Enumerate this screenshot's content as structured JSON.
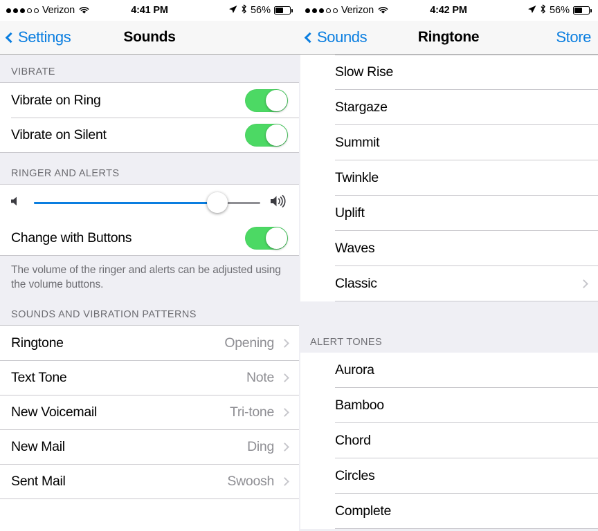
{
  "left": {
    "statusbar": {
      "carrier": "Verizon",
      "signal_filled": 3,
      "signal_hollow": 2,
      "wifi_icon": "wifi-icon",
      "time": "4:41 PM",
      "location_icon": "location-arrow-icon",
      "bluetooth_icon": "bluetooth-icon",
      "battery_percent": "56%",
      "battery_level": 56
    },
    "navbar": {
      "back_label": "Settings",
      "back_icon": "chevron-left-icon",
      "title": "Sounds"
    },
    "vibrate": {
      "header": "VIBRATE",
      "rows": [
        {
          "label": "Vibrate on Ring",
          "toggle": "on"
        },
        {
          "label": "Vibrate on Silent",
          "toggle": "on"
        }
      ]
    },
    "ringer": {
      "header": "RINGER AND ALERTS",
      "slider": {
        "min_icon": "speaker-low-icon",
        "max_icon": "speaker-high-icon",
        "value": 81
      },
      "change_with_buttons": {
        "label": "Change with Buttons",
        "toggle": "on"
      },
      "footer": "The volume of the ringer and alerts can be adjusted using the volume buttons."
    },
    "sounds": {
      "header": "SOUNDS AND VIBRATION PATTERNS",
      "rows": [
        {
          "label": "Ringtone",
          "value": "Opening"
        },
        {
          "label": "Text Tone",
          "value": "Note"
        },
        {
          "label": "New Voicemail",
          "value": "Tri-tone"
        },
        {
          "label": "New Mail",
          "value": "Ding"
        },
        {
          "label": "Sent Mail",
          "value": "Swoosh"
        }
      ]
    }
  },
  "right": {
    "statusbar": {
      "carrier": "Verizon",
      "signal_filled": 3,
      "signal_hollow": 2,
      "wifi_icon": "wifi-icon",
      "time": "4:42 PM",
      "location_icon": "location-arrow-icon",
      "bluetooth_icon": "bluetooth-icon",
      "battery_percent": "56%",
      "battery_level": 56
    },
    "navbar": {
      "back_label": "Sounds",
      "back_icon": "chevron-left-icon",
      "title": "Ringtone",
      "action_label": "Store"
    },
    "ringtones": [
      {
        "label": "Slow Rise",
        "chevron": false
      },
      {
        "label": "Stargaze",
        "chevron": false
      },
      {
        "label": "Summit",
        "chevron": false
      },
      {
        "label": "Twinkle",
        "chevron": false
      },
      {
        "label": "Uplift",
        "chevron": false
      },
      {
        "label": "Waves",
        "chevron": false
      },
      {
        "label": "Classic",
        "chevron": true
      }
    ],
    "alert_tones": {
      "header": "ALERT TONES",
      "items": [
        {
          "label": "Aurora"
        },
        {
          "label": "Bamboo"
        },
        {
          "label": "Chord"
        },
        {
          "label": "Circles"
        },
        {
          "label": "Complete"
        }
      ]
    }
  },
  "colors": {
    "accent_blue": "#0a7ee0",
    "toggle_green": "#4cd964",
    "group_bg": "#efeff4",
    "separator": "#c8c7cc",
    "secondary_text": "#8e8e93"
  }
}
